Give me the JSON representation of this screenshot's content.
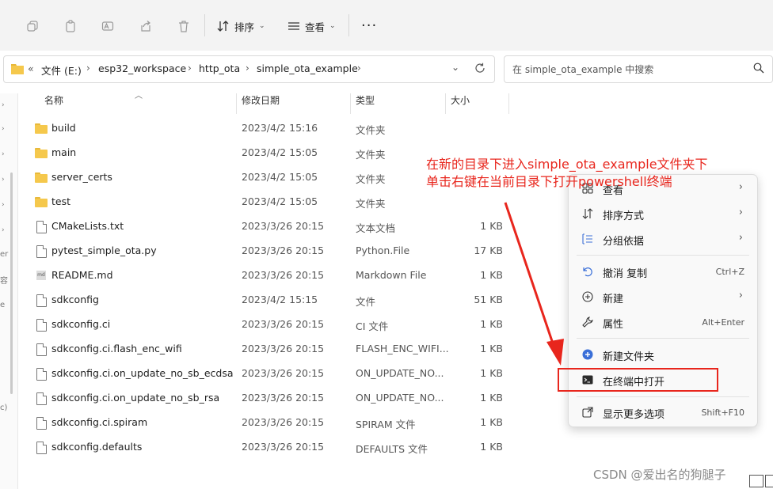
{
  "toolbar": {
    "sort_label": "排序",
    "view_label": "查看",
    "more_label": "···"
  },
  "address": {
    "back_label": "«",
    "crumbs": [
      "文件 (E:)",
      "esp32_workspace",
      "http_ota",
      "simple_ota_example"
    ]
  },
  "search": {
    "placeholder": "在 simple_ota_example 中搜索"
  },
  "columns": {
    "name": "名称",
    "date": "修改日期",
    "type": "类型",
    "size": "大小"
  },
  "files": [
    {
      "name": "build",
      "date": "2023/4/2 15:16",
      "type": "文件夹",
      "size": "",
      "icon": "folder-icon"
    },
    {
      "name": "main",
      "date": "2023/4/2 15:05",
      "type": "文件夹",
      "size": "",
      "icon": "folder-icon"
    },
    {
      "name": "server_certs",
      "date": "2023/4/2 15:05",
      "type": "文件夹",
      "size": "",
      "icon": "folder-icon"
    },
    {
      "name": "test",
      "date": "2023/4/2 15:05",
      "type": "文件夹",
      "size": "",
      "icon": "folder-icon"
    },
    {
      "name": "CMakeLists.txt",
      "date": "2023/3/26 20:15",
      "type": "文本文档",
      "size": "1 KB",
      "icon": "text-file-icon"
    },
    {
      "name": "pytest_simple_ota.py",
      "date": "2023/3/26 20:15",
      "type": "Python.File",
      "size": "17 KB",
      "icon": "file-icon"
    },
    {
      "name": "README.md",
      "date": "2023/3/26 20:15",
      "type": "Markdown File",
      "size": "1 KB",
      "icon": "markdown-file-icon"
    },
    {
      "name": "sdkconfig",
      "date": "2023/4/2 15:15",
      "type": "文件",
      "size": "51 KB",
      "icon": "file-icon"
    },
    {
      "name": "sdkconfig.ci",
      "date": "2023/3/26 20:15",
      "type": "CI 文件",
      "size": "1 KB",
      "icon": "file-icon"
    },
    {
      "name": "sdkconfig.ci.flash_enc_wifi",
      "date": "2023/3/26 20:15",
      "type": "FLASH_ENC_WIFI...",
      "size": "1 KB",
      "icon": "file-icon"
    },
    {
      "name": "sdkconfig.ci.on_update_no_sb_ecdsa",
      "date": "2023/3/26 20:15",
      "type": "ON_UPDATE_NO...",
      "size": "1 KB",
      "icon": "file-icon"
    },
    {
      "name": "sdkconfig.ci.on_update_no_sb_rsa",
      "date": "2023/3/26 20:15",
      "type": "ON_UPDATE_NO...",
      "size": "1 KB",
      "icon": "file-icon"
    },
    {
      "name": "sdkconfig.ci.spiram",
      "date": "2023/3/26 20:15",
      "type": "SPIRAM 文件",
      "size": "1 KB",
      "icon": "file-icon"
    },
    {
      "name": "sdkconfig.defaults",
      "date": "2023/3/26 20:15",
      "type": "DEFAULTS 文件",
      "size": "1 KB",
      "icon": "file-icon"
    }
  ],
  "annotation": {
    "line1": "在新的目录下进入simple_ota_example文件夹下",
    "line2": "单击右键在当前目录下打开powershell终端",
    "color": "#e8261d"
  },
  "context_menu": {
    "items": [
      {
        "label": "查看",
        "shortcut": "",
        "submenu": true,
        "icon": "grid-icon"
      },
      {
        "label": "排序方式",
        "shortcut": "",
        "submenu": true,
        "icon": "sort-icon"
      },
      {
        "label": "分组依据",
        "shortcut": "",
        "submenu": true,
        "icon": "group-icon"
      },
      {
        "label": "撤消 复制",
        "shortcut": "Ctrl+Z",
        "submenu": false,
        "icon": "undo-icon"
      },
      {
        "label": "新建",
        "shortcut": "",
        "submenu": true,
        "icon": "plus-circle-icon"
      },
      {
        "label": "属性",
        "shortcut": "Alt+Enter",
        "submenu": false,
        "icon": "wrench-icon"
      },
      {
        "label": "新建文件夹",
        "shortcut": "",
        "submenu": false,
        "icon": "new-folder-icon"
      },
      {
        "label": "在终端中打开",
        "shortcut": "",
        "submenu": false,
        "icon": "terminal-icon"
      },
      {
        "label": "显示更多选项",
        "shortcut": "Shift+F10",
        "submenu": false,
        "icon": "external-icon"
      }
    ]
  },
  "watermark": "CSDN @爱出名的狗腿子",
  "nav_partial": [
    "er",
    "容",
    "e",
    "c)"
  ]
}
